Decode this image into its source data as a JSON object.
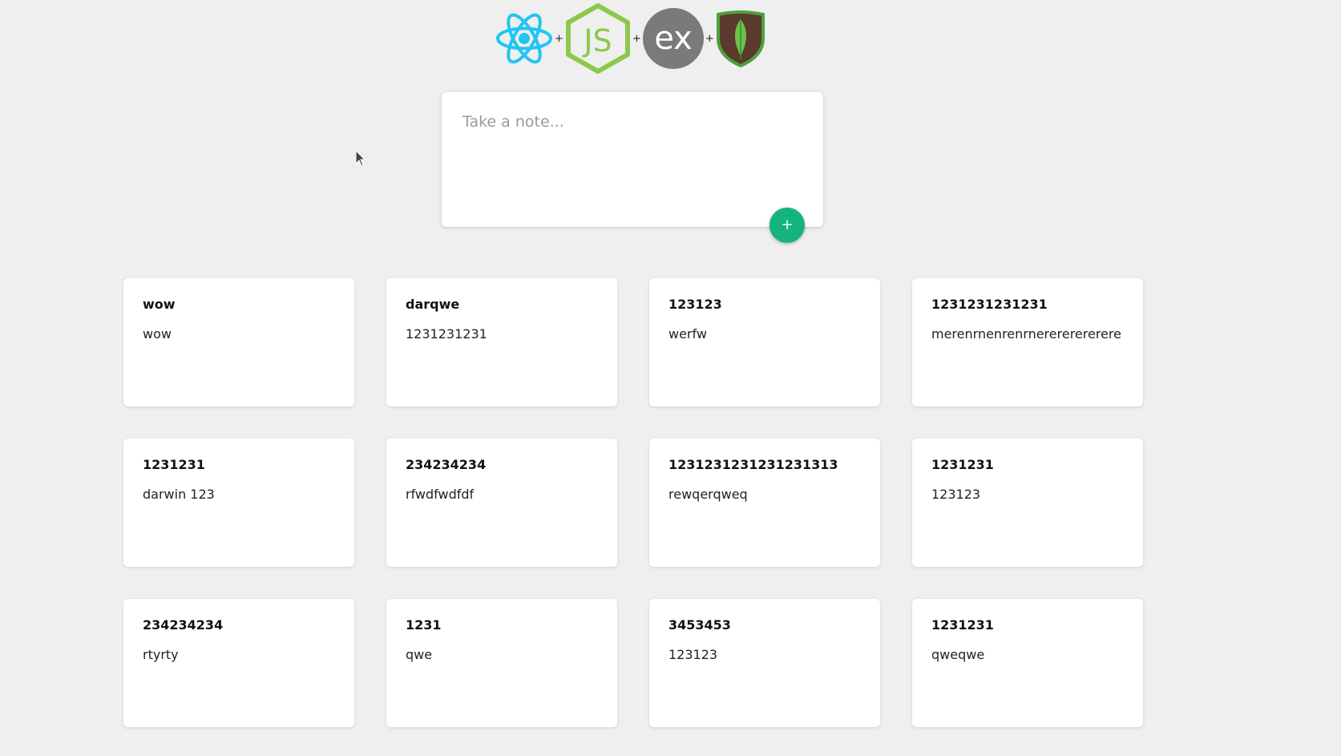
{
  "header": {
    "logos": [
      {
        "name": "react-icon"
      },
      {
        "name": "nodejs-icon",
        "text": "JS"
      },
      {
        "name": "express-icon",
        "text": "ex"
      },
      {
        "name": "mongodb-icon"
      }
    ],
    "separator": "+"
  },
  "create_area": {
    "placeholder": "Take a note...",
    "add_button_label": "+"
  },
  "colors": {
    "background": "#efefef",
    "accent_green": "#13b47f",
    "react_blue": "#20c5f3",
    "node_green": "#8cc84b",
    "express_gray": "#7a7a7a",
    "mongo_brown": "#5a3a2c"
  },
  "notes": [
    {
      "title": "wow",
      "content": "wow"
    },
    {
      "title": "darqwe",
      "content": "1231231231"
    },
    {
      "title": "123123",
      "content": "werfw"
    },
    {
      "title": "1231231231231",
      "content": "merenrnenrenrnerererererere"
    },
    {
      "title": "1231231",
      "content": "darwin 123"
    },
    {
      "title": "234234234",
      "content": "rfwdfwdfdf"
    },
    {
      "title": "1231231231231231313",
      "content": "rewqerqweq"
    },
    {
      "title": "1231231",
      "content": "123123"
    },
    {
      "title": "234234234",
      "content": "rtyrty"
    },
    {
      "title": "1231",
      "content": "qwe"
    },
    {
      "title": "3453453",
      "content": "123123"
    },
    {
      "title": "1231231",
      "content": "qweqwe"
    }
  ]
}
